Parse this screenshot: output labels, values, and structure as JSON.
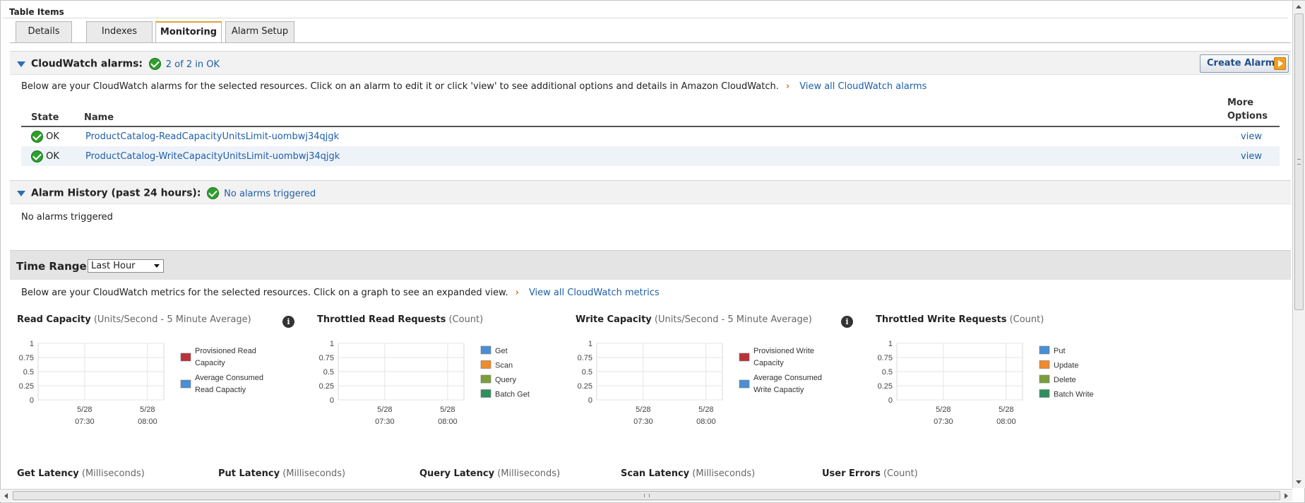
{
  "panel": {
    "title": "Table Items"
  },
  "tabs": [
    {
      "label": "Details"
    },
    {
      "label": "Indexes"
    },
    {
      "label": "Monitoring"
    },
    {
      "label": "Alarm Setup"
    }
  ],
  "alarms": {
    "title": "CloudWatch alarms:",
    "status": "2 of 2 in OK",
    "create_label": "Create Alarm",
    "description": "Below are your CloudWatch alarms for the selected resources. Click on an alarm to edit it or click 'view' to see additional options and details in Amazon CloudWatch.",
    "view_all": "View all CloudWatch alarms",
    "col_state": "State",
    "col_name": "Name",
    "col_more": "More Options",
    "rows": [
      {
        "state": "OK",
        "name": "ProductCatalog-ReadCapacityUnitsLimit-uombwj34qjgk",
        "action": "view"
      },
      {
        "state": "OK",
        "name": "ProductCatalog-WriteCapacityUnitsLimit-uombwj34qjgk",
        "action": "view"
      }
    ]
  },
  "history": {
    "title": "Alarm History (past 24 hours):",
    "status": "No alarms triggered",
    "body": "No alarms triggered"
  },
  "time_range": {
    "label": "Time Range:",
    "value": "Last Hour"
  },
  "metrics": {
    "description": "Below are your CloudWatch metrics for the selected resources. Click on a graph to see an expanded view.",
    "view_all": "View all CloudWatch metrics",
    "charts": [
      {
        "title": "Read Capacity",
        "unit": "(Units/Second - 5 Minute Average)"
      },
      {
        "title": "Throttled Read Requests",
        "unit": "(Count)"
      },
      {
        "title": "Write Capacity",
        "unit": "(Units/Second - 5 Minute Average)"
      },
      {
        "title": "Throttled Write Requests",
        "unit": "(Count)"
      }
    ],
    "lower": [
      {
        "title": "Get Latency",
        "unit": "(Milliseconds)"
      },
      {
        "title": "Put Latency",
        "unit": "(Milliseconds)"
      },
      {
        "title": "Query Latency",
        "unit": "(Milliseconds)"
      },
      {
        "title": "Scan Latency",
        "unit": "(Milliseconds)"
      },
      {
        "title": "User Errors",
        "unit": "(Count)"
      }
    ]
  },
  "chart_data": [
    {
      "type": "line",
      "title": "Read Capacity",
      "ylim": [
        0,
        1
      ],
      "yticks": [
        "1",
        "0.75",
        "0.5",
        "0.25",
        "0"
      ],
      "xticks": [
        [
          "5/28",
          "07:30"
        ],
        [
          "5/28",
          "08:00"
        ]
      ],
      "series": [
        {
          "name": "Provisioned Read Capacity",
          "color": "#b8323a",
          "values": []
        },
        {
          "name": "Average Consumed Read Capactiy",
          "color": "#4a8fd4",
          "values": []
        }
      ]
    },
    {
      "type": "line",
      "title": "Throttled Read Requests",
      "ylim": [
        0,
        1
      ],
      "yticks": [
        "1",
        "0.75",
        "0.5",
        "0.25",
        "0"
      ],
      "xticks": [
        [
          "5/28",
          "07:30"
        ],
        [
          "5/28",
          "08:00"
        ]
      ],
      "series": [
        {
          "name": "Get",
          "color": "#4a8fd4",
          "values": []
        },
        {
          "name": "Scan",
          "color": "#ef8a2e",
          "values": []
        },
        {
          "name": "Query",
          "color": "#7a9e3a",
          "values": []
        },
        {
          "name": "Batch Get",
          "color": "#2e8f5e",
          "values": []
        }
      ]
    },
    {
      "type": "line",
      "title": "Write Capacity",
      "ylim": [
        0,
        1
      ],
      "yticks": [
        "1",
        "0.75",
        "0.5",
        "0.25",
        "0"
      ],
      "xticks": [
        [
          "5/28",
          "07:30"
        ],
        [
          "5/28",
          "08:00"
        ]
      ],
      "series": [
        {
          "name": "Provisioned Write Capacity",
          "color": "#b8323a",
          "values": []
        },
        {
          "name": "Average Consumed Write Capactiy",
          "color": "#4a8fd4",
          "values": []
        }
      ]
    },
    {
      "type": "line",
      "title": "Throttled Write Requests",
      "ylim": [
        0,
        1
      ],
      "yticks": [
        "1",
        "0.75",
        "0.5",
        "0.25",
        "0"
      ],
      "xticks": [
        [
          "5/28",
          "07:30"
        ],
        [
          "5/28",
          "08:00"
        ]
      ],
      "series": [
        {
          "name": "Put",
          "color": "#4a8fd4",
          "values": []
        },
        {
          "name": "Update",
          "color": "#ef8a2e",
          "values": []
        },
        {
          "name": "Delete",
          "color": "#7a9e3a",
          "values": []
        },
        {
          "name": "Batch Write",
          "color": "#2e8f5e",
          "values": []
        }
      ]
    }
  ]
}
